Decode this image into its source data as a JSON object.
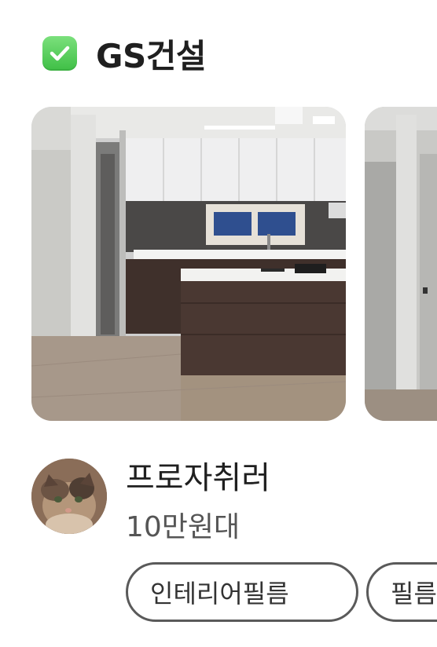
{
  "header": {
    "title": "GS건설",
    "icon": "check-icon",
    "icon_color": "#4cc552"
  },
  "carousel": {
    "photos": [
      {
        "alt": "kitchen-photo"
      },
      {
        "alt": "interior-photo"
      }
    ]
  },
  "user": {
    "nickname": "프로자취러",
    "price": "10만원대",
    "tags": [
      "인테리어필름",
      "필름"
    ]
  }
}
